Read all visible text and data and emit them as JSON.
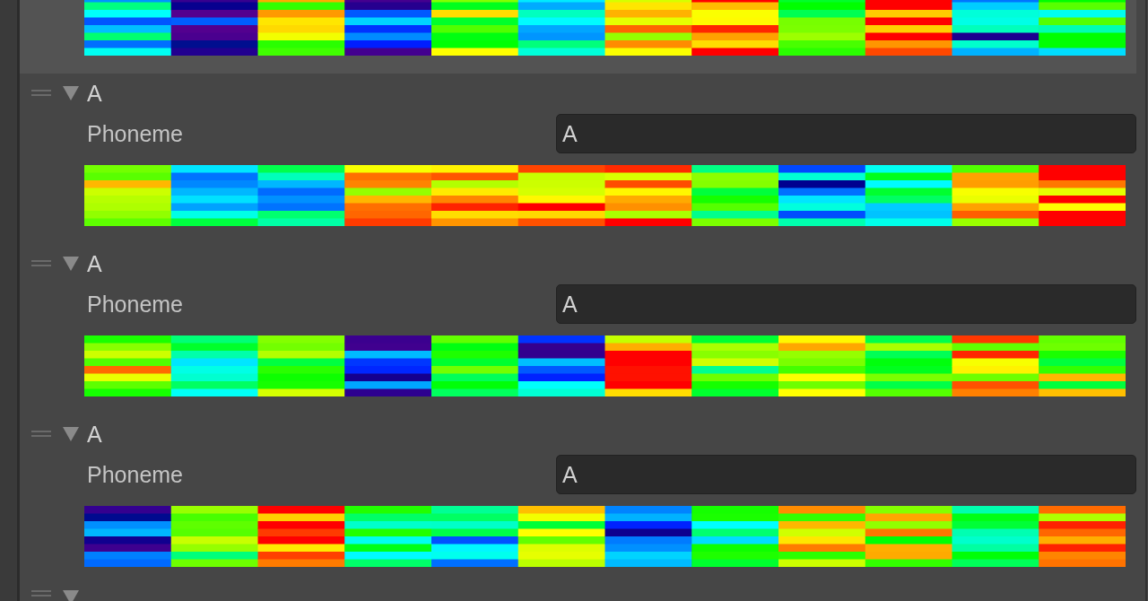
{
  "top_entry": {
    "selected": true
  },
  "entries": [
    {
      "name": "A",
      "field_label": "Phoneme",
      "value": "A",
      "expanded": true
    },
    {
      "name": "A",
      "field_label": "Phoneme",
      "value": "A",
      "expanded": true
    },
    {
      "name": "A",
      "field_label": "Phoneme",
      "value": "A",
      "expanded": true
    }
  ],
  "bottom_entry": {
    "expanded": true
  }
}
